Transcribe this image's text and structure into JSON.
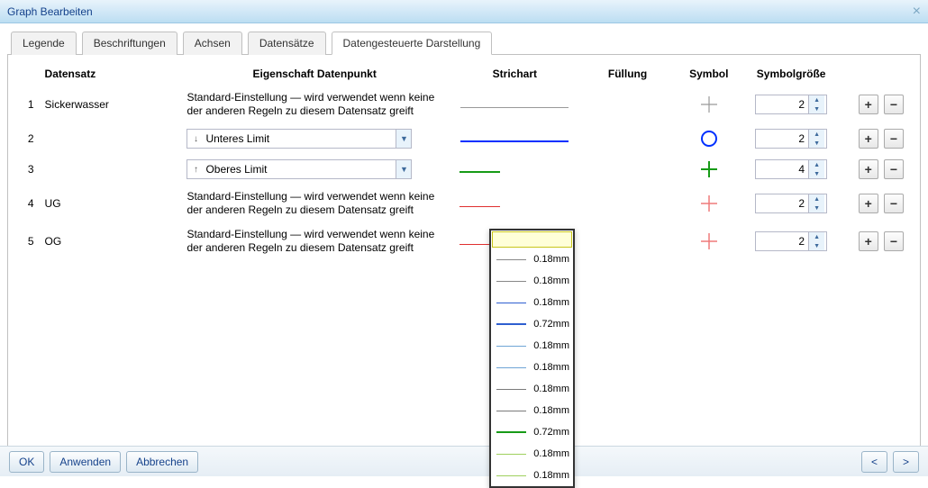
{
  "window": {
    "title": "Graph Bearbeiten"
  },
  "tabs": [
    "Legende",
    "Beschriftungen",
    "Achsen",
    "Datensätze",
    "Datengesteuerte Darstellung"
  ],
  "activeTab": 4,
  "headers": {
    "datensatz": "Datensatz",
    "eigenschaft": "Eigenschaft Datenpunkt",
    "strichart": "Strichart",
    "fuellung": "Füllung",
    "symbol": "Symbol",
    "symbolgroesse": "Symbolgröße"
  },
  "default_text": "Standard-Einstellung — wird verwendet wenn keine der anderen Regeln zu diesem Datensatz greift",
  "rows": [
    {
      "idx": "1",
      "ds": "Sickerwasser",
      "prop_type": "default",
      "stroke": "gray-thin",
      "symbol": "plus-gray",
      "size": "2"
    },
    {
      "idx": "2",
      "ds": "",
      "prop_type": "combo",
      "prop_label": "Unteres Limit",
      "prop_icon": "↓",
      "stroke": "blue",
      "symbol": "circle-blue",
      "size": "2"
    },
    {
      "idx": "3",
      "ds": "",
      "prop_type": "combo",
      "prop_label": "Oberes Limit",
      "prop_icon": "↑",
      "stroke": "green-short",
      "symbol": "plus-green",
      "size": "4"
    },
    {
      "idx": "4",
      "ds": "UG",
      "prop_type": "default",
      "stroke": "red-short",
      "symbol": "plus-red",
      "size": "2"
    },
    {
      "idx": "5",
      "ds": "OG",
      "prop_type": "default",
      "stroke": "red-short",
      "symbol": "plus-red",
      "size": "2"
    }
  ],
  "dropdown": {
    "items": [
      {
        "color": "#888888",
        "bold": false,
        "label": "0.18mm"
      },
      {
        "color": "#888888",
        "bold": false,
        "label": "0.18mm"
      },
      {
        "color": "#2e5fd0",
        "bold": false,
        "label": "0.18mm"
      },
      {
        "color": "#2e5fd0",
        "bold": true,
        "label": "0.72mm"
      },
      {
        "color": "#6fa5d6",
        "bold": false,
        "label": "0.18mm"
      },
      {
        "color": "#6fa5d6",
        "bold": false,
        "label": "0.18mm"
      },
      {
        "color": "#7a7a7a",
        "bold": false,
        "label": "0.18mm"
      },
      {
        "color": "#7a7a7a",
        "bold": false,
        "label": "0.18mm"
      },
      {
        "color": "#179b17",
        "bold": true,
        "label": "0.72mm"
      },
      {
        "color": "#9fd05e",
        "bold": false,
        "label": "0.18mm"
      },
      {
        "color": "#9fd05e",
        "bold": false,
        "label": "0.18mm"
      }
    ]
  },
  "buttons": {
    "ok": "OK",
    "apply": "Anwenden",
    "cancel": "Abbrechen",
    "prev": "<",
    "next": ">"
  }
}
